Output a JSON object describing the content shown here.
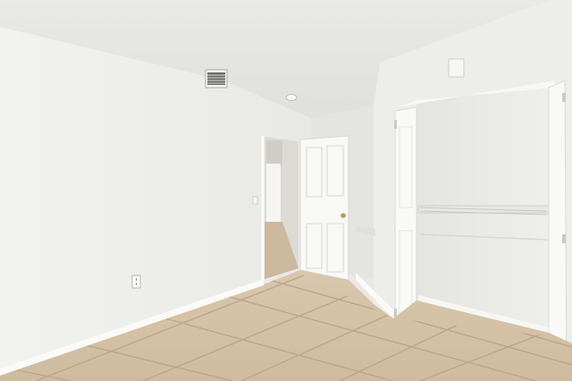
{
  "scene": {
    "subject": "empty-bedroom-interior",
    "elements": [
      "vaulted-ceiling",
      "hvac-vent",
      "smoke-detector",
      "open-doorway",
      "interior-door",
      "closet-bifold-doors",
      "closet-wire-shelf",
      "tile-floor",
      "baseboards",
      "wall-outlet"
    ]
  },
  "colors": {
    "wall": "#efefec",
    "wall_shadow": "#e3e3df",
    "ceiling": "#ebebe8",
    "floor_tile": "#d3c0a5",
    "grout": "#b9a68c",
    "door": "#f8f8f6",
    "baseboard": "#fafaf8"
  }
}
